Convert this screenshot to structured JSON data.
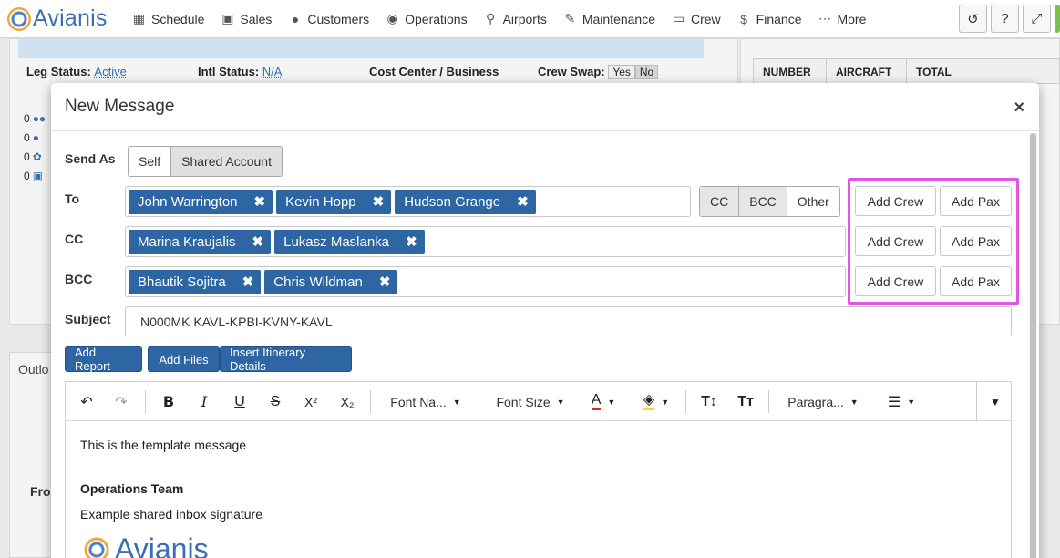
{
  "app": {
    "brand": "Avianis",
    "nav": [
      {
        "label": "Schedule",
        "icon": "calendar-icon"
      },
      {
        "label": "Sales",
        "icon": "cart-icon"
      },
      {
        "label": "Customers",
        "icon": "users-icon"
      },
      {
        "label": "Operations",
        "icon": "globe-icon"
      },
      {
        "label": "Airports",
        "icon": "map-pin-icon"
      },
      {
        "label": "Maintenance",
        "icon": "wrench-icon"
      },
      {
        "label": "Crew",
        "icon": "crew-icon"
      },
      {
        "label": "Finance",
        "icon": "dollar-icon"
      },
      {
        "label": "More",
        "icon": "dots-icon"
      }
    ]
  },
  "background": {
    "leg_status_label": "Leg Status:",
    "leg_status_value": "Active",
    "intl_status_label": "Intl Status:",
    "intl_status_value": "N/A",
    "cost_center_label": "Cost Center / Business",
    "crew_swap_label": "Crew Swap:",
    "crew_swap_yes": "Yes",
    "crew_swap_no": "No",
    "table_headers": [
      "NUMBER",
      "AIRCRAFT",
      "TOTAL"
    ],
    "counts": [
      "0",
      "0",
      "0",
      "0"
    ],
    "side_text_1": "Outlo",
    "side_text_2": "Fro"
  },
  "modal": {
    "title": "New Message",
    "close": "×",
    "send_as_label": "Send As",
    "send_as_options": [
      "Self",
      "Shared Account"
    ],
    "to_label": "To",
    "cc_label": "CC",
    "bcc_label": "BCC",
    "to": [
      "John Warrington",
      "Kevin Hopp",
      "Hudson Grange"
    ],
    "cc": [
      "Marina Kraujalis",
      "Lukasz Maslanka"
    ],
    "bcc": [
      "Bhautik Sojitra",
      "Chris Wildman"
    ],
    "recipient_toggles": [
      "CC",
      "BCC",
      "Other"
    ],
    "add_crew": "Add Crew",
    "add_pax": "Add Pax",
    "subject_label": "Subject",
    "subject_value": "N000MK KAVL-KPBI-KVNY-KAVL",
    "actions": [
      "Add Report",
      "Add Files",
      "Insert Itinerary Details"
    ],
    "toolbar": {
      "font_name": "Font Na...",
      "font_size": "Font Size",
      "paragraph": "Paragra...",
      "superscript": "X²",
      "subscript": "X₂"
    },
    "body": {
      "line1": "This is the template message",
      "signature_title": "Operations Team",
      "signature_text": "Example shared inbox signature",
      "logo_text": "Avianis"
    }
  }
}
